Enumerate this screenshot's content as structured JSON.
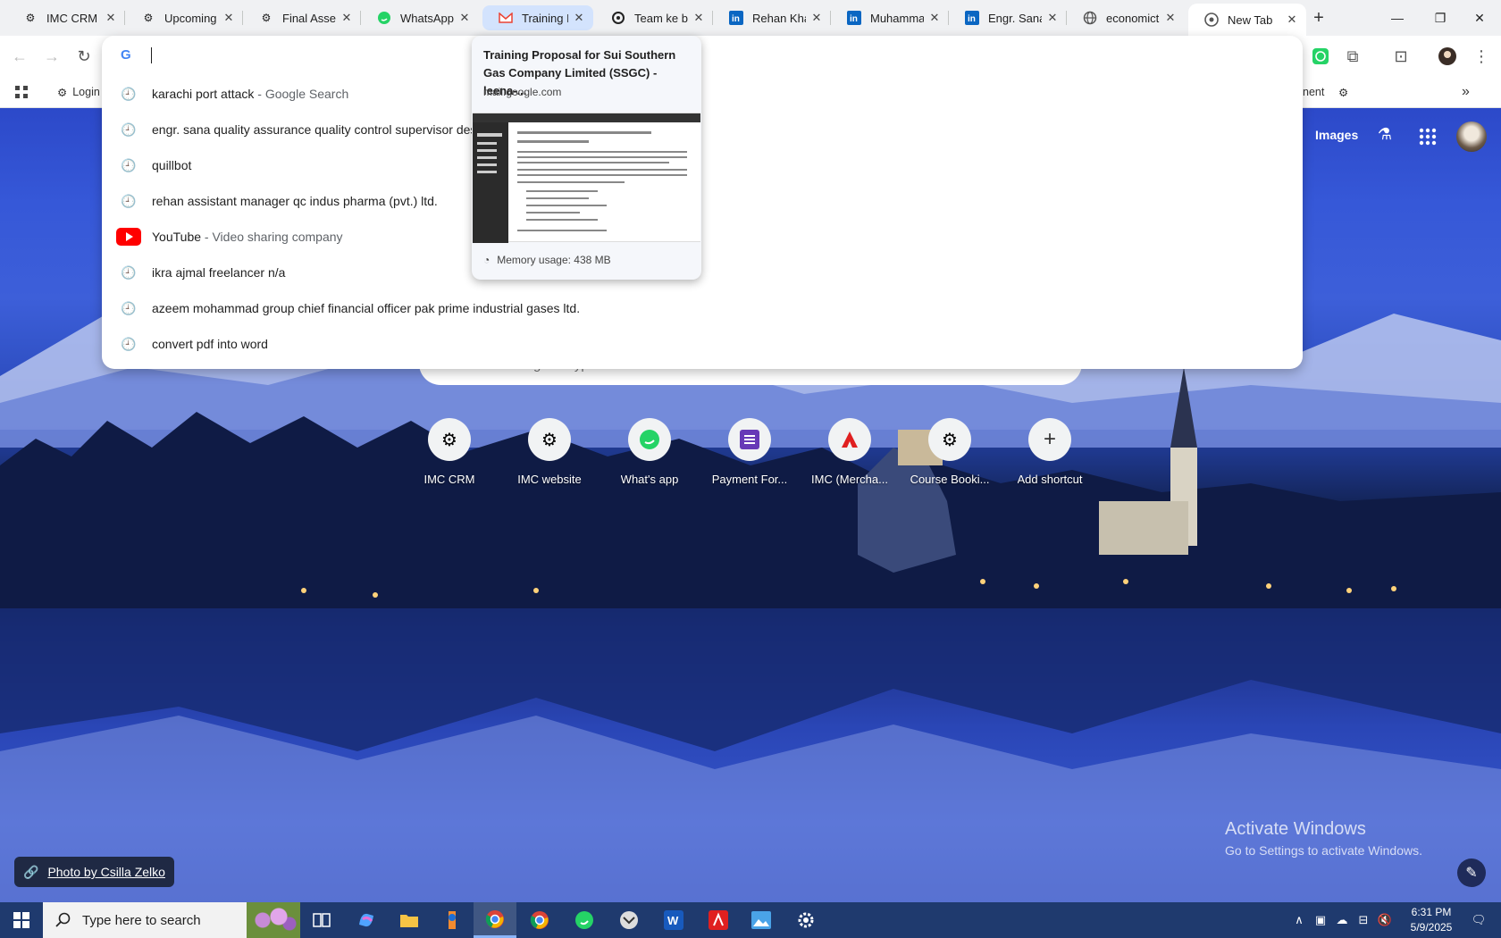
{
  "tabs": [
    {
      "title": "IMC CRM",
      "icon": "imc-icon"
    },
    {
      "title": "Upcoming",
      "icon": "imc-icon"
    },
    {
      "title": "Final Assess",
      "icon": "imc-icon"
    },
    {
      "title": "WhatsApp",
      "icon": "whatsapp-icon"
    },
    {
      "title": "Training Pro",
      "icon": "gmail-icon"
    },
    {
      "title": "Team ke be",
      "icon": "chatgpt-icon"
    },
    {
      "title": "Rehan Khan",
      "icon": "linkedin-icon"
    },
    {
      "title": "Muhammad",
      "icon": "linkedin-icon"
    },
    {
      "title": "Engr. Sana",
      "icon": "linkedin-icon"
    },
    {
      "title": "economicti",
      "icon": "globe-icon"
    },
    {
      "title": "New Tab",
      "icon": "chrome-icon"
    }
  ],
  "toolbar": {
    "omnibox_value": ""
  },
  "bookmarks": {
    "first": "Login",
    "last": "nent"
  },
  "omnibox": {
    "suggestions": [
      {
        "text": "karachi port attack",
        "sub": " - Google Search",
        "icon": "history-icon"
      },
      {
        "text": "engr. sana quality assurance quality control supervisor des",
        "sub": "",
        "icon": "history-icon"
      },
      {
        "text": "quillbot",
        "sub": "",
        "icon": "history-icon"
      },
      {
        "text": "rehan assistant manager qc indus pharma (pvt.) ltd.",
        "sub": "",
        "icon": "history-icon"
      },
      {
        "text": "YouTube",
        "sub": " - Video sharing company",
        "icon": "youtube-icon"
      },
      {
        "text": "ikra ajmal freelancer n/a",
        "sub": "",
        "icon": "history-icon"
      },
      {
        "text": "azeem mohammad group chief financial officer pak prime industrial gases ltd.",
        "sub": "",
        "icon": "history-icon"
      },
      {
        "text": "convert pdf into word",
        "sub": "",
        "icon": "history-icon"
      }
    ]
  },
  "hovercard": {
    "title": "Training Proposal for Sui Southern Gas Company Limited (SSGC) - leena-...",
    "domain": "mail.google.com",
    "memory": "Memory usage: 438 MB"
  },
  "ntp": {
    "images_link": "Images",
    "search_placeholder": "Search Google or type a URL",
    "shortcuts": [
      {
        "label": "IMC CRM",
        "icon": "imc-icon"
      },
      {
        "label": "IMC website",
        "icon": "imc-icon"
      },
      {
        "label": "What's app",
        "icon": "whatsapp-icon"
      },
      {
        "label": "Payment For...",
        "icon": "forms-icon"
      },
      {
        "label": "IMC (Mercha...",
        "icon": "adobe-icon"
      },
      {
        "label": "Course Booki...",
        "icon": "imc-icon"
      },
      {
        "label": "Add shortcut",
        "icon": "plus-icon"
      }
    ],
    "photo_credit": "Photo by Csilla Zelko"
  },
  "watermark": {
    "line1": "Activate Windows",
    "line2": "Go to Settings to activate Windows."
  },
  "taskbar": {
    "search_placeholder": "Type here to search",
    "time": "6:31 PM",
    "date": "5/9/2025"
  },
  "colors": {
    "accent": "#0b57d0",
    "tab_hover": "#d3e3fd",
    "taskbar": "#1f3a6e"
  }
}
